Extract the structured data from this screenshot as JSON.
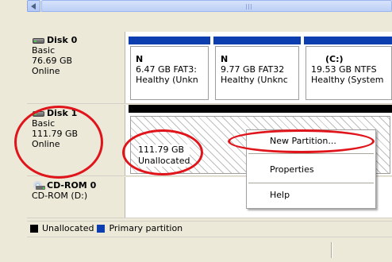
{
  "disks": [
    {
      "name": "Disk 0",
      "type": "Basic",
      "size": "76.69 GB",
      "status": "Online",
      "partitions": [
        {
          "letter": "N",
          "size": "6.47 GB FAT3:",
          "status": "Healthy (Unkn"
        },
        {
          "letter": "N",
          "size": "9.77 GB FAT32",
          "status": "Healthy (Unknc"
        },
        {
          "letter": "(C:)",
          "size": "19.53 GB NTFS",
          "status": "Healthy (System"
        }
      ]
    },
    {
      "name": "Disk 1",
      "type": "Basic",
      "size": "111.79 GB",
      "status": "Online",
      "unallocated": {
        "size": "111.79 GB",
        "label": "Unallocated"
      }
    },
    {
      "name": "CD-ROM 0",
      "drive": "CD-ROM (D:)"
    }
  ],
  "legend": {
    "unallocated": {
      "label": "Unallocated",
      "color": "#000000"
    },
    "primary": {
      "label": "Primary partition",
      "color": "#0c3eb0"
    }
  },
  "context_menu": {
    "items": [
      {
        "label": "New Partition..."
      },
      {
        "label": "Properties"
      },
      {
        "label": "Help"
      }
    ]
  },
  "colors": {
    "annotation": "#e0141b",
    "primary_partition": "#0c3eb0",
    "unallocated": "#000000"
  }
}
